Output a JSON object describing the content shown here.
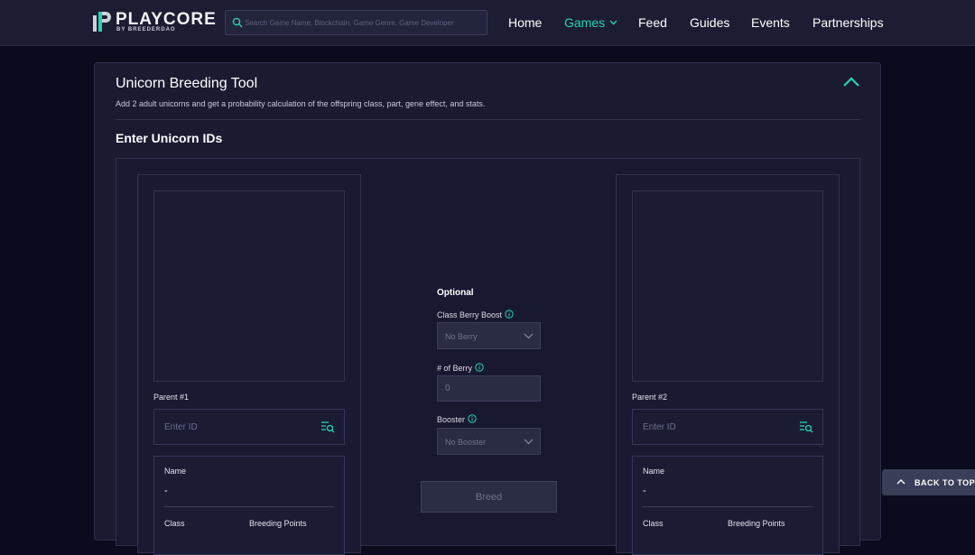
{
  "brand": {
    "name": "PLAYCORE",
    "byline": "BY BREEDERDAO",
    "accent_color": "#26d3b4"
  },
  "search": {
    "placeholder": "Search Game Name, Blockchain, Game Genre, Game Developer"
  },
  "nav": {
    "items": [
      {
        "label": "Home"
      },
      {
        "label": "Games"
      },
      {
        "label": "Feed"
      },
      {
        "label": "Guides"
      },
      {
        "label": "Events"
      },
      {
        "label": "Partnerships"
      }
    ],
    "active": "Games"
  },
  "tool": {
    "title": "Unicorn Breeding Tool",
    "description": "Add 2 adult unicorns and get a probability calculation of the offspring class, part, gene effect, and stats.",
    "section_title": "Enter Unicorn IDs"
  },
  "parents": [
    {
      "label": "Parent #1",
      "id_placeholder": "Enter ID",
      "name_label": "Name",
      "name_value": "-",
      "class_label": "Class",
      "breeding_points_label": "Breeding Points"
    },
    {
      "label": "Parent #2",
      "id_placeholder": "Enter ID",
      "name_label": "Name",
      "name_value": "-",
      "class_label": "Class",
      "breeding_points_label": "Breeding Points"
    }
  ],
  "optional": {
    "title": "Optional",
    "berry_boost_label": "Class Berry Boost",
    "berry_boost_value": "No Berry",
    "berry_count_label": "# of Berry",
    "berry_count_value": "0",
    "booster_label": "Booster",
    "booster_value": "No Booster",
    "breed_label": "Breed"
  },
  "back_to_top": {
    "label": "BACK TO TOP"
  }
}
